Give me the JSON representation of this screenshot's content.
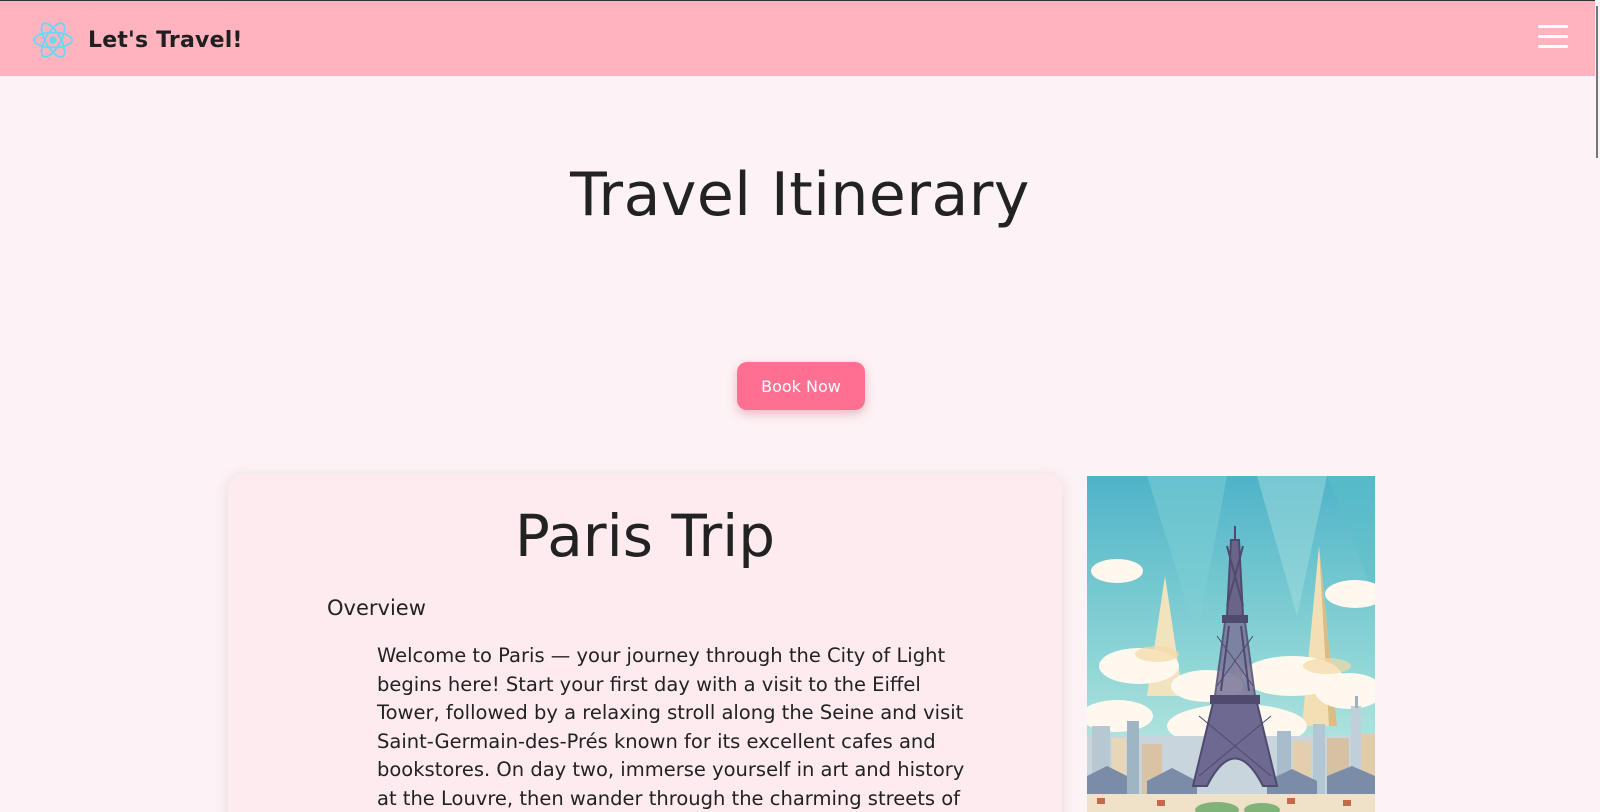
{
  "navbar": {
    "brand_text": "Let's Travel!",
    "logo_icon": "react-atom-icon",
    "menu_icon": "hamburger-menu-icon"
  },
  "main": {
    "title": "Travel Itinerary",
    "book_button_label": "Book Now"
  },
  "trip": {
    "title": "Paris Trip",
    "overview_heading": "Overview",
    "overview_text": "Welcome to Paris — your journey through the City of Light begins here! Start your first day with a visit to the Eiffel Tower, followed by a relaxing stroll along the Seine and visit Saint-Germain-des-Prés known for its excellent cafes and bookstores. On day two, immerse yourself in art and history at the Louvre, then wander through the charming streets of Le Marais for",
    "image": "eiffel-tower-illustration"
  },
  "colors": {
    "navbar_bg": "#ffb3bf",
    "page_bg": "#fdf2f5",
    "card_bg": "#fdebf0",
    "button_bg": "#ff6f91",
    "logo": "#61dafb"
  }
}
